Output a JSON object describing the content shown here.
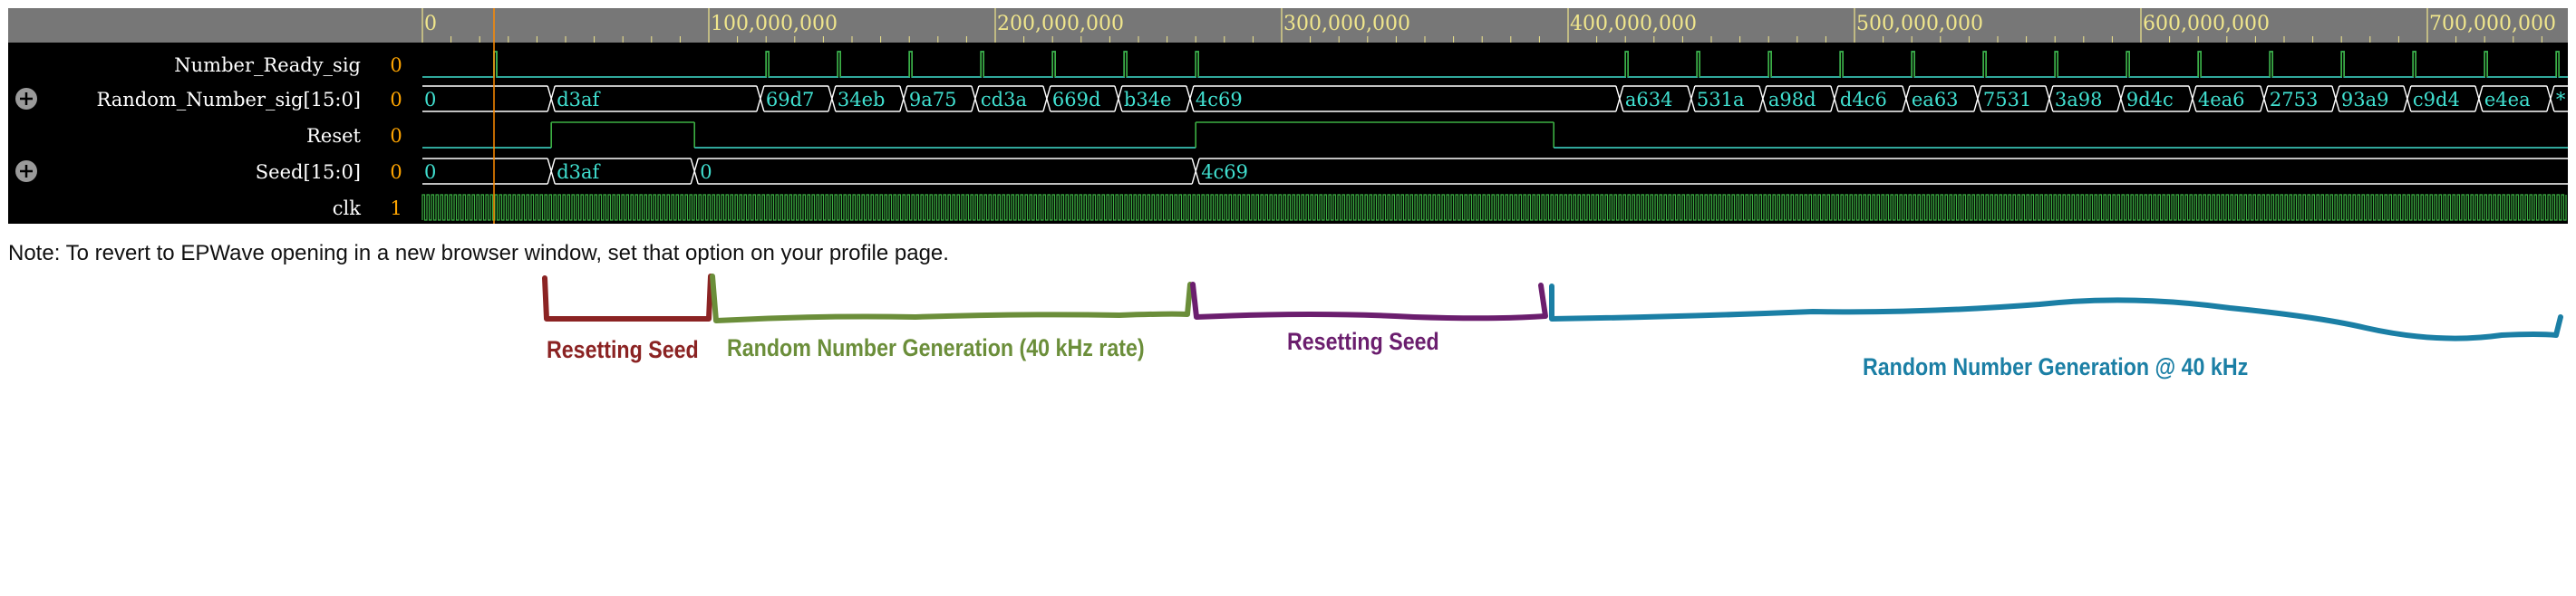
{
  "time_ruler": {
    "labels": [
      "0",
      "100,000,000",
      "200,000,000",
      "300,000,000",
      "400,000,000",
      "500,000,000",
      "600,000,000",
      "700,000,000"
    ],
    "max_time": 750000000
  },
  "cursor_time": 25000000,
  "signals": [
    {
      "name": "Number_Ready_sig",
      "value": "0",
      "type": "pulse",
      "expandable": false,
      "pulses": [
        25000000,
        120000000,
        145000000,
        170000000,
        195000000,
        220000000,
        245000000,
        270000000,
        420000000,
        445000000,
        470000000,
        495000000,
        520000000,
        545000000,
        570000000,
        595000000,
        620000000,
        645000000,
        670000000,
        695000000,
        720000000,
        745000000
      ]
    },
    {
      "name": "Random_Number_sig[15:0]",
      "value": "0",
      "type": "bus",
      "expandable": true,
      "segments": [
        {
          "t": 0,
          "v": "0"
        },
        {
          "t": 45000000,
          "v": "d3af"
        },
        {
          "t": 118000000,
          "v": "69d7"
        },
        {
          "t": 143000000,
          "v": "34eb"
        },
        {
          "t": 168000000,
          "v": "9a75"
        },
        {
          "t": 193000000,
          "v": "cd3a"
        },
        {
          "t": 218000000,
          "v": "669d"
        },
        {
          "t": 243000000,
          "v": "b34e"
        },
        {
          "t": 268000000,
          "v": "4c69"
        },
        {
          "t": 418000000,
          "v": "a634"
        },
        {
          "t": 443000000,
          "v": "531a"
        },
        {
          "t": 468000000,
          "v": "a98d"
        },
        {
          "t": 493000000,
          "v": "d4c6"
        },
        {
          "t": 518000000,
          "v": "ea63"
        },
        {
          "t": 543000000,
          "v": "7531"
        },
        {
          "t": 568000000,
          "v": "3a98"
        },
        {
          "t": 593000000,
          "v": "9d4c"
        },
        {
          "t": 618000000,
          "v": "4ea6"
        },
        {
          "t": 643000000,
          "v": "2753"
        },
        {
          "t": 668000000,
          "v": "93a9"
        },
        {
          "t": 693000000,
          "v": "c9d4"
        },
        {
          "t": 718000000,
          "v": "e4ea"
        },
        {
          "t": 743000000,
          "v": "*"
        }
      ]
    },
    {
      "name": "Reset",
      "value": "0",
      "type": "bit",
      "expandable": false,
      "edges": [
        {
          "t": 0,
          "v": 0
        },
        {
          "t": 45000000,
          "v": 1
        },
        {
          "t": 95000000,
          "v": 0
        },
        {
          "t": 270000000,
          "v": 1
        },
        {
          "t": 395000000,
          "v": 0
        }
      ]
    },
    {
      "name": "Seed[15:0]",
      "value": "0",
      "type": "bus",
      "expandable": true,
      "segments": [
        {
          "t": 0,
          "v": "0"
        },
        {
          "t": 45000000,
          "v": "d3af"
        },
        {
          "t": 95000000,
          "v": "0"
        },
        {
          "t": 270000000,
          "v": "4c69"
        }
      ]
    },
    {
      "name": "clk",
      "value": "1",
      "type": "clock",
      "expandable": false
    }
  ],
  "note": "Note: To revert to EPWave opening in a new browser window, set that option on your profile page.",
  "annotations": [
    {
      "label": "Resetting Seed",
      "color": "#8b2323"
    },
    {
      "label": "Random Number Generation (40 kHz rate)",
      "color": "#6b8e3a"
    },
    {
      "label": "Resetting Seed",
      "color": "#6b1e6e"
    },
    {
      "label": "Random Number Generation @ 40 kHz",
      "color": "#1b7fa5"
    }
  ],
  "colors": {
    "ruler_bg": "#777777",
    "ruler_text": "#f0e68c",
    "wave_bg": "#000000",
    "signal_name": "#ffffff",
    "value": "#ffa500",
    "bit_high": "#3cb043",
    "bit_low": "#40e0d0",
    "bus": "#ffffff",
    "bus_text": "#40e0d0",
    "clock": "#3cb043",
    "cursor": "#ff8c00"
  }
}
